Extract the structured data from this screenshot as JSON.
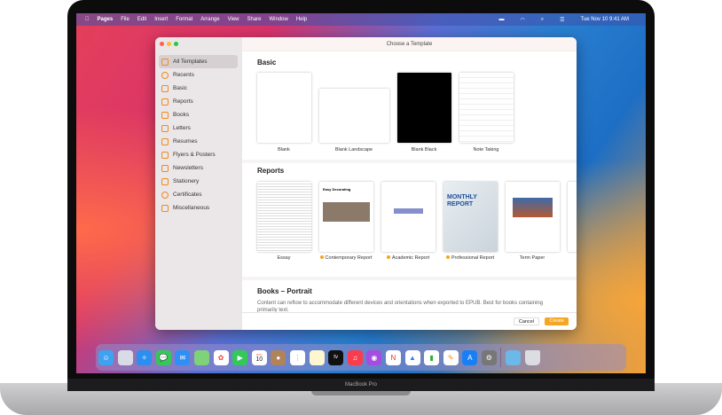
{
  "menubar": {
    "items": [
      "Pages",
      "File",
      "Edit",
      "Insert",
      "Format",
      "Arrange",
      "View",
      "Share",
      "Window",
      "Help"
    ],
    "clock": "Tue Nov 10  9:41 AM"
  },
  "window": {
    "title": "Choose a Template"
  },
  "sidebar": {
    "items": [
      {
        "label": "All Templates"
      },
      {
        "label": "Recents"
      },
      {
        "label": "Basic"
      },
      {
        "label": "Reports"
      },
      {
        "label": "Books"
      },
      {
        "label": "Letters"
      },
      {
        "label": "Resumes"
      },
      {
        "label": "Flyers & Posters"
      },
      {
        "label": "Newsletters"
      },
      {
        "label": "Stationery"
      },
      {
        "label": "Certificates"
      },
      {
        "label": "Miscellaneous"
      }
    ]
  },
  "sections": {
    "basic": {
      "title": "Basic",
      "templates": [
        "Blank",
        "Blank Landscape",
        "Blank Black",
        "Note Taking"
      ]
    },
    "reports": {
      "title": "Reports",
      "templates": [
        "Essay",
        "Contemporary Report",
        "Academic Report",
        "Professional Report",
        "Term Paper"
      ],
      "thumb_texts": {
        "monthly": "MONTHLY REPORT",
        "decor": "Easy Decorating"
      }
    },
    "books": {
      "title": "Books – Portrait",
      "description": "Content can reflow to accommodate different devices and orientations when exported to EPUB. Best for books containing primarily text."
    }
  },
  "footer": {
    "cancel": "Cancel",
    "create": "Create"
  },
  "dock": {
    "calendar_month": "NOV",
    "calendar_day": "10",
    "tv": "tv"
  },
  "laptop": {
    "label": "MacBook Pro"
  },
  "colors": {
    "accent": "#f5a623",
    "sidebar_icon": "#f08a1d"
  }
}
